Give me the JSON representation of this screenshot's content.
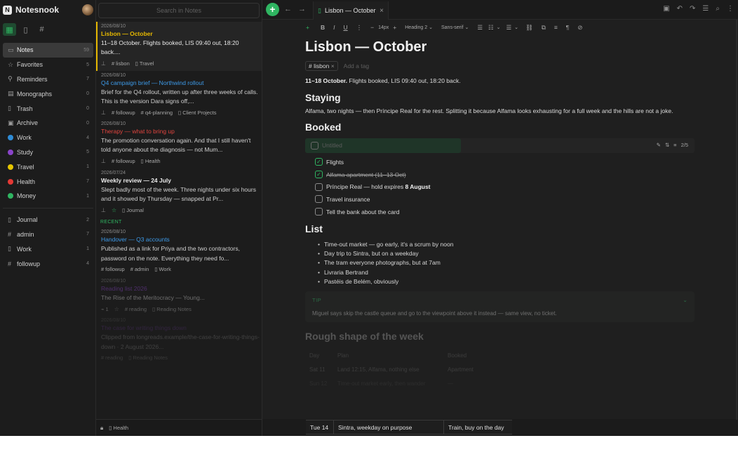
{
  "app": {
    "name": "Notesnook",
    "logo_letter": "N"
  },
  "sidebar": {
    "tabs": [
      {
        "icon": "notes-grid-icon"
      },
      {
        "icon": "notebook-icon"
      },
      {
        "icon": "hash-icon"
      }
    ],
    "items": [
      {
        "label": "Notes",
        "count": "59",
        "icon": "▭"
      },
      {
        "label": "Favorites",
        "count": "5",
        "icon": "☆"
      },
      {
        "label": "Reminders",
        "count": "7",
        "icon": "⚲"
      },
      {
        "label": "Monographs",
        "count": "0",
        "icon": "▤"
      },
      {
        "label": "Trash",
        "count": "0",
        "icon": "▯"
      },
      {
        "label": "Archive",
        "count": "0",
        "icon": "▣"
      }
    ],
    "colors": [
      {
        "label": "Work",
        "count": "4",
        "color": "#2f8cd6"
      },
      {
        "label": "Study",
        "count": "5",
        "color": "#8a44c9"
      },
      {
        "label": "Travel",
        "count": "1",
        "color": "#e6c600"
      },
      {
        "label": "Health",
        "count": "7",
        "color": "#e53935"
      },
      {
        "label": "Money",
        "count": "1",
        "color": "#2fb561"
      }
    ],
    "shortcuts": [
      {
        "label": "Journal",
        "count": "2",
        "icon": "▯"
      },
      {
        "label": "admin",
        "count": "7",
        "icon": "#"
      },
      {
        "label": "Work",
        "count": "1",
        "icon": "▯"
      },
      {
        "label": "followup",
        "count": "4",
        "icon": "#"
      }
    ]
  },
  "list": {
    "search_placeholder": "Search in Notes",
    "notes": [
      {
        "date": "2026/08/10",
        "title": "Lisbon — October",
        "title_color": "#e6b800",
        "body": "11–18 October. Flights booked, LIS 09:40 out, 18:20 back....",
        "tags": [
          "lisbon"
        ],
        "notebook": "Travel"
      },
      {
        "date": "2026/08/10",
        "title": "Q4 campaign brief — Northwind rollout",
        "title_color": "#3d9ae8",
        "body": "Brief for the Q4 rollout, written up after three weeks of calls. This is the version Dara signs off,...",
        "tags": [
          "followup",
          "q4-planning"
        ],
        "notebook": "Client Projects"
      },
      {
        "date": "2026/08/10",
        "title": "Therapy — what to bring up",
        "title_color": "#e0443e",
        "body": "The promotion conversation again. And that I still haven't told anyone about the diagnosis — not Mum...",
        "tags": [
          "followup"
        ],
        "notebook": "Health"
      },
      {
        "date": "2026/07/24",
        "title": "Weekly review — 24 July",
        "title_color": "#e9e9e9",
        "body": "Slept badly most of the week. Three nights under six hours and it showed by Thursday — snapped at Pr...",
        "tags": [],
        "notebook": "Journal"
      }
    ],
    "recent_label": "RECENT",
    "recent_notes": [
      {
        "date": "2026/08/10",
        "title": "Handover — Q3 accounts",
        "title_color": "#3d9ae8",
        "body": "Published as a link for Priya and the two contractors, password on the note. Everything they need fo...",
        "tags": [
          "followup",
          "admin"
        ],
        "notebook": "Work"
      },
      {
        "date": "2026/08/10",
        "title": "Reading list 2026",
        "title_color": "#8a44c9",
        "body": "The Rise of the Meritocracy — Young...",
        "tags": [
          "reading"
        ],
        "notebook": "Reading Notes",
        "prefix": "1"
      },
      {
        "date": "2026/08/10",
        "title": "The case for writing things down",
        "title_color": "#8a44c9",
        "body": "Clipped from longreads.example/the-case-for-writing-things-down · 2 August 2026...",
        "tags": [
          "reading"
        ],
        "notebook": "Reading Notes"
      }
    ],
    "footer_notebook": "Health"
  },
  "editor": {
    "tab_title": "Lisbon — October",
    "toolbar": {
      "font_size": "14px",
      "heading": "Heading 2",
      "font": "Sans-serif"
    },
    "title": "Lisbon — October",
    "tag": "lisbon",
    "add_tag_placeholder": "Add a tag",
    "intro_bold": "11–18 October.",
    "intro_rest": " Flights booked, LIS 09:40 out, 18:20 back.",
    "h_staying": "Staying",
    "staying_text": "Alfama, two nights — then Príncipe Real for the rest. Splitting it because Alfama looks exhausting for a full week and the hills are not a joke.",
    "h_booked": "Booked",
    "task_list": {
      "title": "Untitled",
      "progress": "2/5",
      "done_fraction": 0.4
    },
    "checklist": [
      {
        "text": "Flights",
        "done": true
      },
      {
        "text": "Alfama apartment (11–13 Oct)",
        "done": true
      },
      {
        "text": "Príncipe Real — hold expires ",
        "bold": "8 August",
        "done": false
      },
      {
        "text": "Travel insurance",
        "done": false
      },
      {
        "text": "Tell the bank about the card",
        "done": false
      }
    ],
    "h_list": "List",
    "bullets": [
      "Time-out market — go early, it's a scrum by noon",
      "Day trip to Sintra, but on a weekday",
      "The tram everyone photographs, but at 7am",
      "Livraria Bertrand",
      "Pastéis de Belém, obviously"
    ],
    "callout": {
      "label": "TIP",
      "text": "Miguel says skip the castle queue and go to the viewpoint above it instead — same view, no ticket."
    },
    "h_rough": "Rough shape of the week",
    "table": {
      "headers": [
        "Day",
        "Plan",
        "Booked"
      ],
      "rows": [
        [
          "Sat 11",
          "Land 12:15, Alfama, nothing else",
          "Apartment"
        ],
        [
          "Sun 12",
          "Time-out market early, then wander",
          "—"
        ]
      ],
      "visible_row": [
        "Tue 14",
        "Sintra, weekday on purpose",
        "Train, buy on the day"
      ]
    }
  }
}
